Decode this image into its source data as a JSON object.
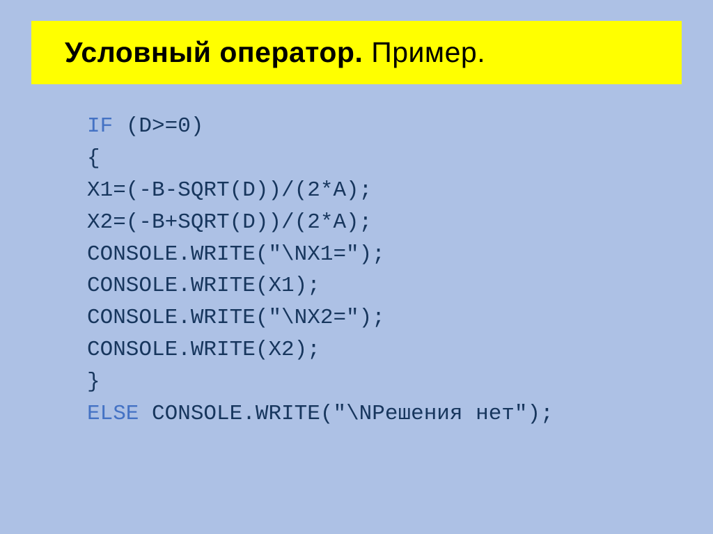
{
  "title": {
    "bold": "Условный оператор.",
    "rest": " Пример."
  },
  "code": {
    "line1_keyword": "IF",
    "line1_rest": " (D>=0)",
    "line2": "{",
    "line3": " X1=(-B-SQRT(D))/(2*A);",
    "line4": " X2=(-B+SQRT(D))/(2*A);",
    "line5": " CONSOLE.WRITE(\"\\NX1=\");",
    "line6": " CONSOLE.WRITE(X1);",
    "line7": " CONSOLE.WRITE(\"\\NX2=\");",
    "line8": " CONSOLE.WRITE(X2);",
    "line9": "}",
    "line10_keyword": "ELSE",
    "line10_rest": " CONSOLE.WRITE(\"\\NРешения нет\");"
  }
}
